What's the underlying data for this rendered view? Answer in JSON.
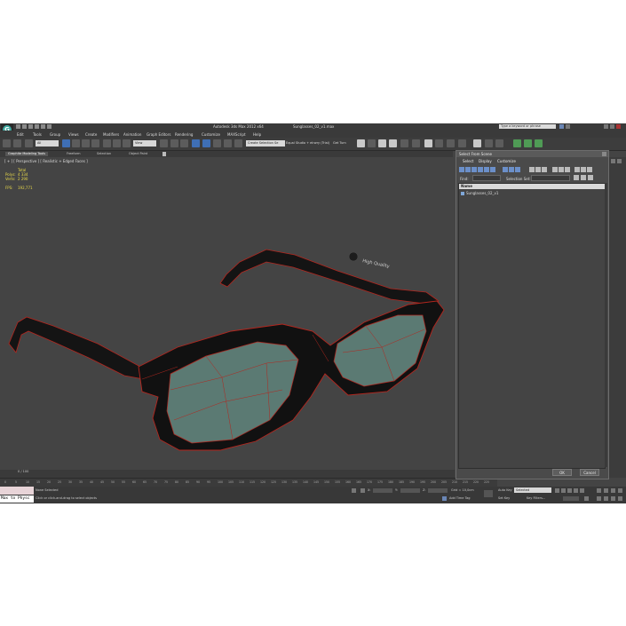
{
  "window": {
    "title": "Autodesk 3ds Max  2012 x64",
    "filename": "Sunglasses_02_v1.max",
    "search_placeholder": "Type a keyword or phrase"
  },
  "menu": [
    "Edit",
    "Tools",
    "Group",
    "Views",
    "Create",
    "Modifiers",
    "Animation",
    "Graph Editors",
    "Rendering",
    "Customize",
    "MAXScript",
    "Help"
  ],
  "toolbar": {
    "filter": "All",
    "ref_coord": "View",
    "selection_set": "Create Selection Se",
    "equal_studio": "Equal Studio + elrwry (Trial)",
    "get_turn": "Get Turn"
  },
  "ribbon_tabs": [
    "Graphite Modeling Tools",
    "Freeform",
    "Selection",
    "Object Paint"
  ],
  "viewport": {
    "label": "[ + ] [ Perspective ] [ Realistic + Edged Faces ]",
    "stats": {
      "total_label": "Total",
      "polys_label": "Polys:",
      "polys_value": "4 334",
      "verts_label": "Verts:",
      "verts_value": "2 290",
      "fps_label": "FPS:",
      "fps_value": "192,771"
    },
    "temple_text": "High Quality"
  },
  "timeline": {
    "slider": "0 / 100",
    "ticks": [
      "0",
      "5",
      "10",
      "15",
      "20",
      "25",
      "30",
      "35",
      "40",
      "45",
      "50",
      "55",
      "60",
      "65",
      "70",
      "75",
      "80",
      "85",
      "90",
      "95",
      "100",
      "105",
      "110",
      "115",
      "120",
      "125",
      "130",
      "135",
      "140",
      "145",
      "150",
      "155",
      "160",
      "165",
      "170",
      "175",
      "180",
      "185",
      "190",
      "195",
      "200",
      "205",
      "210",
      "215",
      "220",
      "225"
    ]
  },
  "status": {
    "maxscript": "Max to Physc",
    "selection": "None Selected",
    "prompt": "Click or click-and-drag to select objects",
    "x_label": "X:",
    "y_label": "Y:",
    "z_label": "Z:",
    "grid": "Grid = 10,0cm",
    "add_time_tag": "Add Time Tag",
    "auto_key": "Auto Key",
    "selected": "Selected",
    "set_key": "Set Key",
    "key_filters": "Key Filters..."
  },
  "dialog": {
    "title": "Select From Scene",
    "menu": [
      "Select",
      "Display",
      "Customize"
    ],
    "find_label": "Find:",
    "find_value": "",
    "selset_label": "Selection Set:",
    "column_header": "Name",
    "items": [
      "Sunglasses_02_v1"
    ],
    "ok": "OK",
    "cancel": "Cancel"
  },
  "colors": {
    "viewport_bg": "#444444",
    "wireframe": "#c0392b",
    "lens": "#5b7a73",
    "stats": "#e8d94a"
  }
}
